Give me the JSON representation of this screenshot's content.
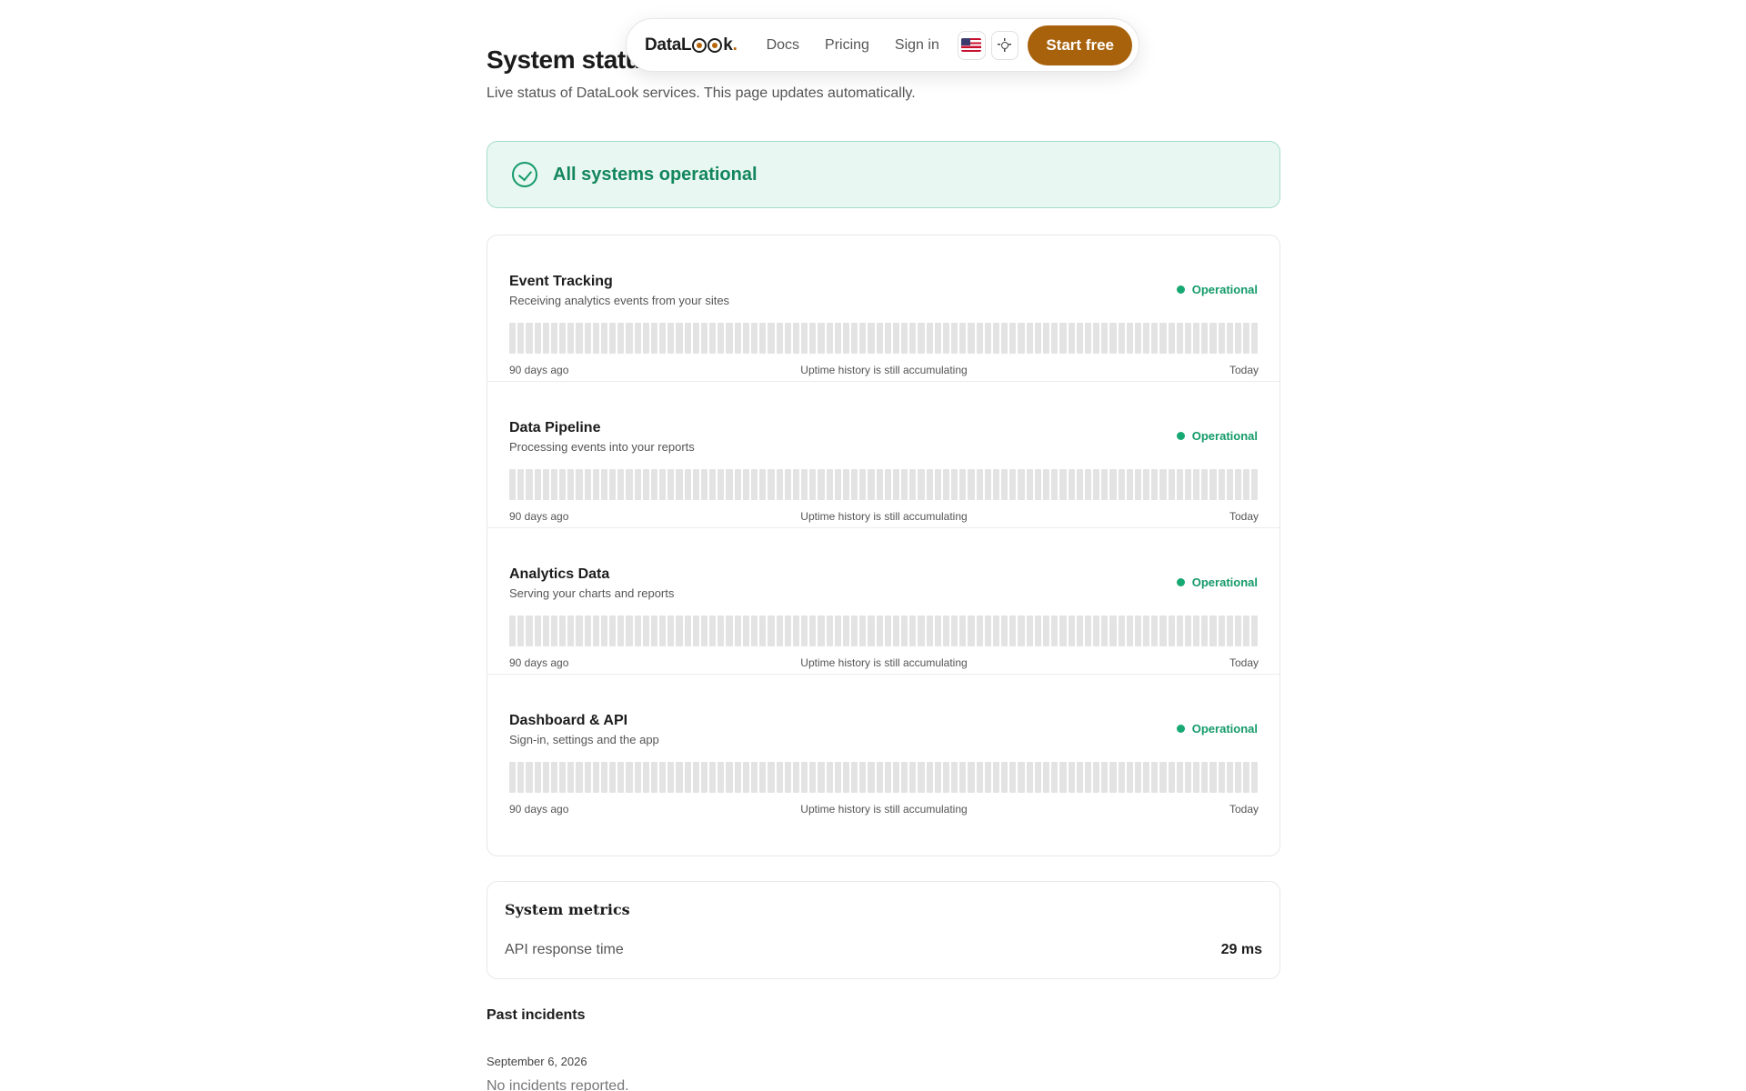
{
  "nav": {
    "logo_prefix": "DataL",
    "logo_suffix": "k",
    "logo_dot": ".",
    "links": [
      "Docs",
      "Pricing",
      "Sign in"
    ],
    "language_icon": "us-flag-icon",
    "theme_icon": "sun-icon",
    "cta_label": "Start free"
  },
  "header": {
    "title": "System status",
    "subtitle": "Live status of DataLook services. This page updates automatically."
  },
  "banner": {
    "icon": "check-circle-icon",
    "text": "All systems operational"
  },
  "services": [
    {
      "name": "Event Tracking",
      "description": "Receiving analytics events from your sites",
      "status": "Operational",
      "start_label": "90 days ago",
      "center_label": "Uptime history is still accumulating",
      "end_label": "Today"
    },
    {
      "name": "Data Pipeline",
      "description": "Processing events into your reports",
      "status": "Operational",
      "start_label": "90 days ago",
      "center_label": "Uptime history is still accumulating",
      "end_label": "Today"
    },
    {
      "name": "Analytics Data",
      "description": "Serving your charts and reports",
      "status": "Operational",
      "start_label": "90 days ago",
      "center_label": "Uptime history is still accumulating",
      "end_label": "Today"
    },
    {
      "name": "Dashboard & API",
      "description": "Sign-in, settings and the app",
      "status": "Operational",
      "start_label": "90 days ago",
      "center_label": "Uptime history is still accumulating",
      "end_label": "Today"
    }
  ],
  "colors": {
    "accent": "#a8620c",
    "operational": "#18a873",
    "banner_bg": "#e8f7f1",
    "bar_empty": "#e3e3e3"
  },
  "metrics": {
    "title": "System metrics",
    "api_response_label": "API response time",
    "api_response_value": "29 ms"
  },
  "incidents": {
    "title": "Past incidents",
    "date": "September 6, 2026",
    "text": "No incidents reported."
  }
}
